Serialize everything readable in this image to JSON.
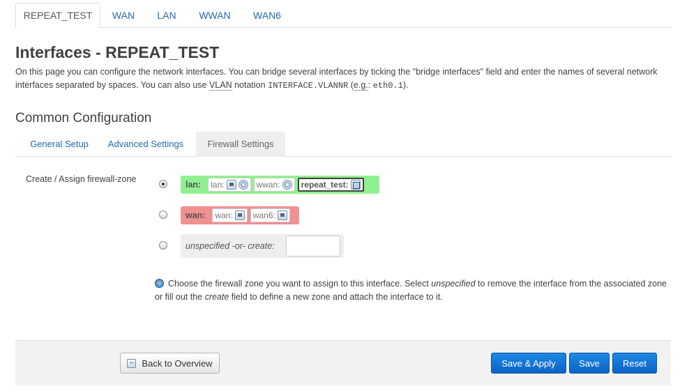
{
  "top_tabs": [
    "REPEAT_TEST",
    "WAN",
    "LAN",
    "WWAN",
    "WAN6"
  ],
  "page": {
    "title": "Interfaces - REPEAT_TEST",
    "desc_part1": "On this page you can configure the network interfaces. You can bridge several interfaces by ticking the \"bridge interfaces\" field and enter the names of several network interfaces separated by spaces. You can also use ",
    "desc_vlan": "VLAN",
    "desc_part2": " notation ",
    "desc_code1": "INTERFACE.VLANNR",
    "desc_part3": " (",
    "desc_eg": "e.g.",
    "desc_part4": ": ",
    "desc_code2": "eth0.1",
    "desc_part5": ")."
  },
  "section": {
    "title": "Common Configuration",
    "tabs": [
      "General Setup",
      "Advanced Settings",
      "Firewall Settings"
    ]
  },
  "firewall": {
    "label": "Create / Assign firewall-zone",
    "zones": [
      {
        "name": "lan:",
        "color": "#90f090",
        "interfaces": [
          {
            "label": "lan:",
            "icon": "ethernet-icon"
          },
          {
            "label": "wwan:",
            "icon": "wifi-icon"
          },
          {
            "label": "repeat_test:",
            "icon": "bridge-icon"
          }
        ]
      },
      {
        "name": "wan:",
        "color": "#f09090",
        "interfaces": [
          {
            "label": "wan:",
            "icon": "ethernet-icon"
          },
          {
            "label": "wan6:",
            "icon": "ethernet-icon"
          }
        ]
      }
    ],
    "unspecified_label": "unspecified -or- create:",
    "create_value": "",
    "help_part1": "Choose the firewall zone you want to assign to this interface. Select ",
    "help_em1": "unspecified",
    "help_part2": " to remove the interface from the associated zone or fill out the ",
    "help_em2": "create",
    "help_part3": " field to define a new zone and attach the interface to it."
  },
  "footer": {
    "back_label": "Back to Overview",
    "save_apply_label": "Save & Apply",
    "save_label": "Save",
    "reset_label": "Reset",
    "primary_color": "#0b63c4"
  }
}
